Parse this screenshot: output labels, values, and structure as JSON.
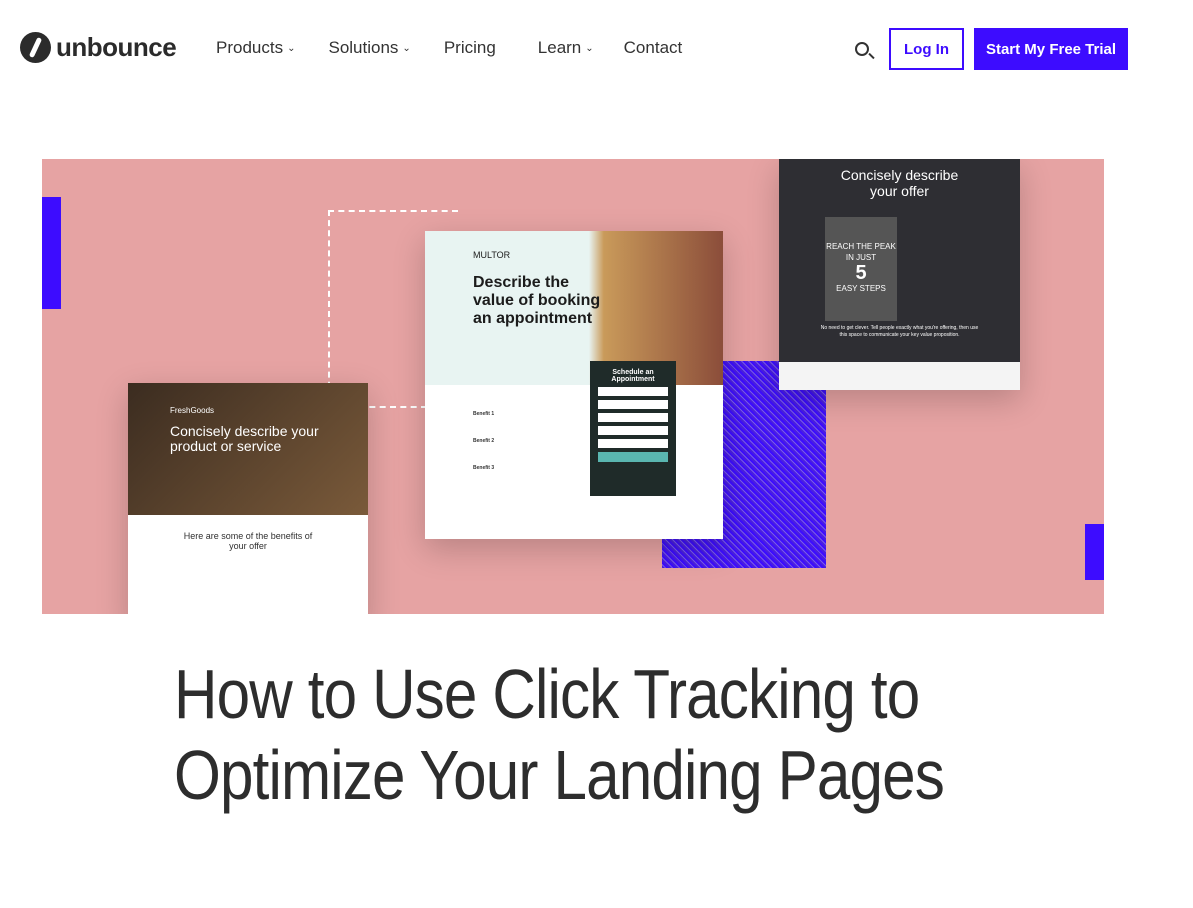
{
  "header": {
    "logo": "unbounce",
    "menu": [
      {
        "label": "Products",
        "dropdown": true
      },
      {
        "label": "Solutions",
        "dropdown": true
      },
      {
        "label": "Pricing",
        "dropdown": false
      },
      {
        "label": "Learn",
        "dropdown": true
      },
      {
        "label": "Contact",
        "dropdown": false
      }
    ],
    "search_icon": "search-icon",
    "login": "Log In",
    "trial": "Start My Free Trial"
  },
  "hero": {
    "colors": {
      "background": "#e6a3a3",
      "accent": "#3d0cff"
    },
    "card_left": {
      "brand": "FreshGoods",
      "headline": "Concisely describe your product or service",
      "benefits_title": "Here are some of the benefits of your offer"
    },
    "card_center": {
      "brand": "MULTOR",
      "headline": "Describe the value of booking an appointment",
      "form_title": "Schedule an Appointment",
      "benefits": [
        "Benefit 1",
        "Benefit 2",
        "Benefit 3"
      ]
    },
    "card_right": {
      "headline": "Concisely describe your offer",
      "book_top": "REACH THE PEAK IN JUST",
      "book_num": "5",
      "book_bottom": "EASY STEPS",
      "footer": "No need to get clever. Tell people exactly what you're offering, then use this space to communicate your key value proposition."
    }
  },
  "article": {
    "title": "How to Use Click Tracking to Optimize Your Landing Pages"
  }
}
